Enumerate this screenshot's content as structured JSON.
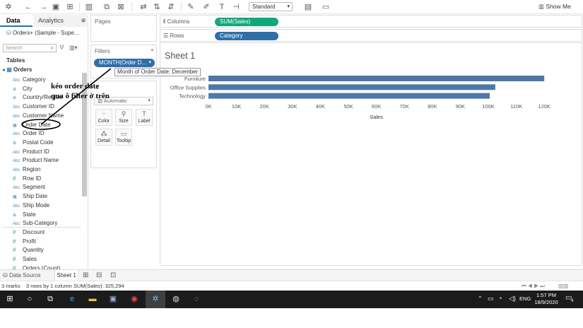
{
  "toolbar": {
    "fit_value": "Standard",
    "show_me_label": "Show Me"
  },
  "left_pane": {
    "tabs": [
      "Data",
      "Analytics"
    ],
    "datasource": "Orders+ (Sample - Supe...",
    "search_placeholder": "Search",
    "tables_label": "Tables",
    "table_name": "Orders",
    "fields": [
      {
        "label": "Category",
        "icon": "Abc"
      },
      {
        "label": "City",
        "icon": "globe"
      },
      {
        "label": "Country/Region",
        "icon": "globe"
      },
      {
        "label": "Customer ID",
        "icon": "Abc"
      },
      {
        "label": "Customer Name",
        "icon": "Abc"
      },
      {
        "label": "Order Date",
        "icon": "calendar"
      },
      {
        "label": "Order ID",
        "icon": "Abc"
      },
      {
        "label": "Postal Code",
        "icon": "globe"
      },
      {
        "label": "Product ID",
        "icon": "Abc"
      },
      {
        "label": "Product Name",
        "icon": "Abc"
      },
      {
        "label": "Region",
        "icon": "Abc"
      },
      {
        "label": "Row ID",
        "icon": "#"
      },
      {
        "label": "Segment",
        "icon": "Abc"
      },
      {
        "label": "Ship Date",
        "icon": "calendar"
      },
      {
        "label": "Ship Mode",
        "icon": "Abc"
      },
      {
        "label": "State",
        "icon": "globe"
      },
      {
        "label": "Sub-Category",
        "icon": "Abc"
      },
      {
        "label": "Discount",
        "icon": "#"
      },
      {
        "label": "Profit",
        "icon": "#"
      },
      {
        "label": "Quantity",
        "icon": "#"
      },
      {
        "label": "Sales",
        "icon": "#"
      },
      {
        "label": "Orders (Count)",
        "icon": "#"
      }
    ]
  },
  "pages_label": "Pages",
  "filters_label": "Filters",
  "filter_pill": "MONTH(Order D...",
  "filter_tooltip": "Month of Order Date: December",
  "marks": {
    "type": "Automatic",
    "buttons": [
      "Color",
      "Size",
      "Label",
      "Detail",
      "Tooltip"
    ]
  },
  "shelves": {
    "columns_label": "Columns",
    "columns_pill": "SUM(Sales)",
    "rows_label": "Rows",
    "rows_pill": "Category"
  },
  "annotation": {
    "line1": "kéo order date",
    "line2": "qua ô filter ở trên"
  },
  "sheet_title": "Sheet 1",
  "chart_data": {
    "type": "bar",
    "orientation": "horizontal",
    "categories": [
      "Furniture",
      "Office Supplies",
      "Technology"
    ],
    "values": [
      120000,
      102500,
      100500
    ],
    "xlabel": "Sales",
    "xlim": [
      0,
      125000
    ],
    "ticks": [
      "0K",
      "10K",
      "20K",
      "30K",
      "40K",
      "50K",
      "60K",
      "70K",
      "80K",
      "90K",
      "100K",
      "110K",
      "120K"
    ],
    "bar_color": "#4e79a7"
  },
  "sheet_tabs": {
    "data_source": "Data Source",
    "sheet": "Sheet 1"
  },
  "status": {
    "marks": "3 marks",
    "rows_cols": "3 rows by 1 column",
    "sum": "SUM(Sales): 325,294"
  },
  "taskbar": {
    "time": "1:57 PM",
    "date": "18/9/2020",
    "lang": "ENG",
    "notif_count": "4"
  }
}
